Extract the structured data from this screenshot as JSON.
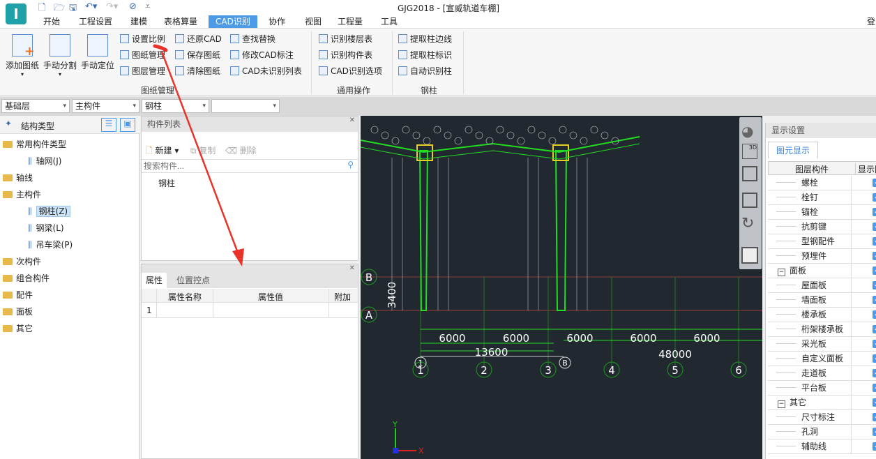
{
  "app": {
    "title": "GJG2018 - [宣威轨道车棚]",
    "logo_letter": "I",
    "account": "登"
  },
  "menu_tabs": [
    "开始",
    "工程设置",
    "建模",
    "表格算量",
    "CAD识别",
    "协作",
    "视图",
    "工程量",
    "工具"
  ],
  "active_tab": "CAD识别",
  "ribbon": {
    "big_buttons": [
      "添加图纸",
      "手动分割",
      "手动定位"
    ],
    "col1": [
      "设置比例",
      "图纸管理",
      "图层管理"
    ],
    "col2": [
      "还原CAD",
      "保存图纸",
      "清除图纸"
    ],
    "col3": [
      "查找替换",
      "修改CAD标注",
      "CAD未识别列表"
    ],
    "group1": "图纸管理",
    "col4": [
      "识别楼层表",
      "识别构件表",
      "CAD识别选项"
    ],
    "group2": "通用操作",
    "col5": [
      "提取柱边线",
      "提取柱标识",
      "自动识别柱"
    ],
    "group3": "钢柱"
  },
  "combos": [
    "基础层",
    "主构件",
    "钢柱",
    ""
  ],
  "left_panel": {
    "title": "结构类型",
    "tree": [
      {
        "label": "常用构件类型",
        "level": 0
      },
      {
        "label": "轴网(J)",
        "level": 1
      },
      {
        "label": "轴线",
        "level": 0
      },
      {
        "label": "主构件",
        "level": 0
      },
      {
        "label": "钢柱(Z)",
        "level": 1,
        "selected": true
      },
      {
        "label": "钢梁(L)",
        "level": 1
      },
      {
        "label": "吊车梁(P)",
        "level": 1
      },
      {
        "label": "次构件",
        "level": 0
      },
      {
        "label": "组合构件",
        "level": 0
      },
      {
        "label": "配件",
        "level": 0
      },
      {
        "label": "面板",
        "level": 0
      },
      {
        "label": "其它",
        "level": 0
      }
    ]
  },
  "component_list": {
    "title": "构件列表",
    "new": "新建",
    "copy": "复制",
    "delete": "删除",
    "search_placeholder": "搜索构件...",
    "items": [
      "钢柱"
    ]
  },
  "properties": {
    "tabs": [
      "属性",
      "位置控点"
    ],
    "headers": [
      "属性名称",
      "属性值",
      "附加"
    ],
    "rows": [
      {
        "index": "1",
        "name": "",
        "value": ""
      }
    ]
  },
  "cad": {
    "row_axes": [
      "B",
      "A"
    ],
    "col_axes": [
      "1",
      "2",
      "3",
      "4",
      "5",
      "6"
    ],
    "dims": [
      "6000",
      "6000",
      "6000",
      "6000",
      "6000"
    ],
    "dim_13600": "13600",
    "dim_48000": "48000",
    "dim_3400": "3400",
    "sub_axis_1": "1",
    "sub_axis_b": "B",
    "coord_y": "Y",
    "coord_x": "X"
  },
  "display_settings": {
    "title": "显示设置",
    "tab": "图元显示",
    "headers": [
      "图层构件",
      "显示图"
    ],
    "rows": [
      {
        "label": "螺栓",
        "level": 1
      },
      {
        "label": "栓钉",
        "level": 1
      },
      {
        "label": "锚栓",
        "level": 1
      },
      {
        "label": "抗剪键",
        "level": 1
      },
      {
        "label": "型钢配件",
        "level": 1
      },
      {
        "label": "预埋件",
        "level": 1
      },
      {
        "label": "面板",
        "level": 0
      },
      {
        "label": "屋面板",
        "level": 1
      },
      {
        "label": "墙面板",
        "level": 1
      },
      {
        "label": "楼承板",
        "level": 1
      },
      {
        "label": "桁架楼承板",
        "level": 1
      },
      {
        "label": "采光板",
        "level": 1
      },
      {
        "label": "自定义面板",
        "level": 1
      },
      {
        "label": "走道板",
        "level": 1
      },
      {
        "label": "平台板",
        "level": 1
      },
      {
        "label": "其它",
        "level": 0
      },
      {
        "label": "尺寸标注",
        "level": 1
      },
      {
        "label": "孔洞",
        "level": 1
      },
      {
        "label": "辅助线",
        "level": 1
      }
    ]
  },
  "colors": {
    "accent": "#4d9be6",
    "cad_bg": "#212830",
    "cad_green": "#22dd22",
    "annotation": "#e8332a"
  }
}
